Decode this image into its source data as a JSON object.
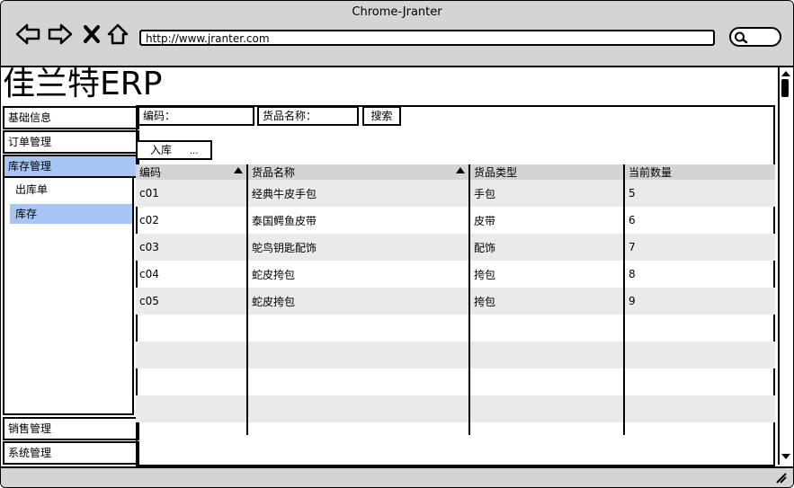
{
  "browser": {
    "window_title": "Chrome-Jranter",
    "url": "http://www.jranter.com",
    "icons": [
      "back-icon",
      "forward-icon",
      "close-icon",
      "home-icon",
      "search-icon"
    ]
  },
  "app": {
    "title": "佳兰特ERP"
  },
  "sidebar": {
    "items": [
      {
        "label": "基础信息"
      },
      {
        "label": "订单管理"
      },
      {
        "label": "库存管理",
        "selected": true
      },
      {
        "label": "销售管理"
      },
      {
        "label": "系统管理"
      }
    ],
    "subitems": [
      {
        "label": "出库单"
      },
      {
        "label": "库存",
        "selected": true
      }
    ]
  },
  "filters": {
    "code_label": "编码：",
    "name_label": "货品名称：",
    "search_button": "搜索",
    "inbound_button": "入库",
    "inbound_ellipsis": "..."
  },
  "table": {
    "columns": [
      "编码",
      "货品名称",
      "货品类型",
      "当前数量"
    ],
    "rows": [
      [
        "c01",
        "经典牛皮手包",
        "手包",
        "5"
      ],
      [
        "c02",
        "泰国鳄鱼皮带",
        "皮带",
        "6"
      ],
      [
        "c03",
        "鸵鸟钥匙配饰",
        "配饰",
        "7"
      ],
      [
        "c04",
        "蛇皮挎包",
        "挎包",
        "8"
      ],
      [
        "c05",
        "蛇皮挎包",
        "挎包",
        "9"
      ]
    ]
  },
  "colors": {
    "chrome_gray": "#d4d4d4",
    "selected_blue": "#a7c5f5",
    "row_alt": "#eaeaea"
  }
}
